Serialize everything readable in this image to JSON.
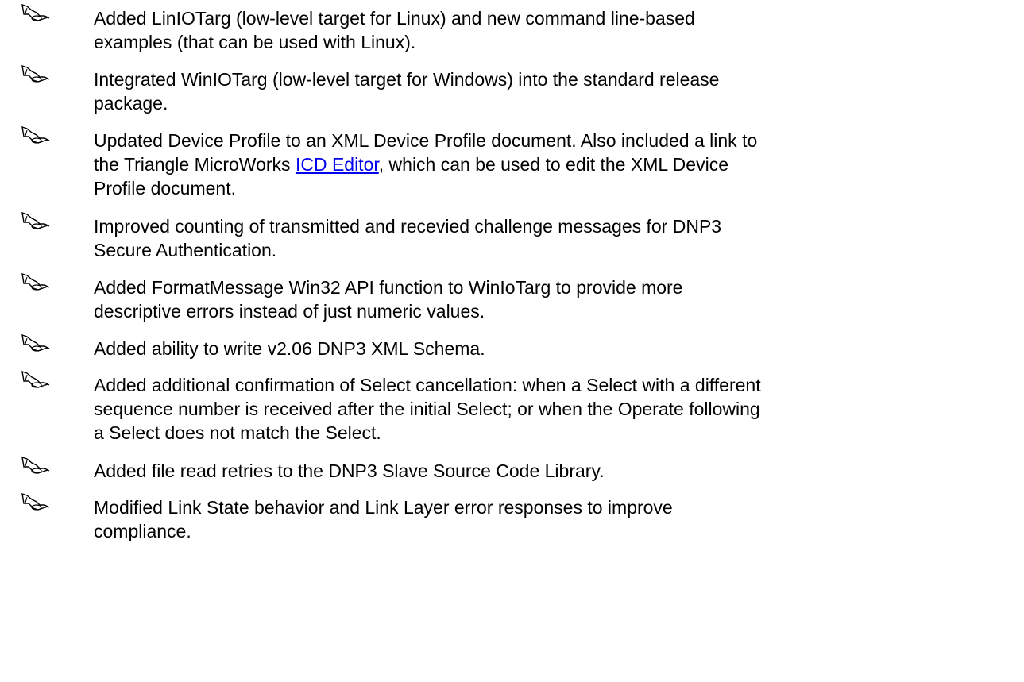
{
  "document": {
    "link_color": "#0000ee",
    "bullet_icon": "hand-pointer-icon",
    "items": [
      {
        "lines": [
          "Added LinIOTarg (low-level target for Linux) and new command line-based",
          "examples (that can be used with Linux)."
        ]
      },
      {
        "lines": [
          "Integrated WinIOTarg (low-level target for Windows) into the standard release",
          "package."
        ]
      },
      {
        "line1": "Updated Device Profile to an XML Device Profile document. Also included a link to",
        "line2_before": "the Triangle MicroWorks ",
        "link_text": "ICD Editor",
        "line2_after": ", which can be used to edit the XML Device",
        "line3": "Profile document."
      },
      {
        "lines": [
          "Improved counting of transmitted and recevied challenge messages for DNP3",
          "Secure Authentication."
        ]
      },
      {
        "lines": [
          "Added FormatMessage Win32 API function to WinIoTarg to provide more",
          "descriptive errors instead of just numeric values."
        ]
      },
      {
        "lines": [
          "Added ability to write v2.06 DNP3 XML Schema."
        ]
      },
      {
        "lines": [
          "Added additional confirmation of Select cancellation: when a Select with a different",
          "sequence number is received after the initial Select; or when the Operate following",
          "a Select does not match the Select."
        ]
      },
      {
        "lines": [
          "Added file read retries to the DNP3 Slave Source Code Library."
        ]
      },
      {
        "lines": [
          "Modified Link State behavior and Link Layer error responses to improve",
          "compliance."
        ]
      }
    ]
  }
}
